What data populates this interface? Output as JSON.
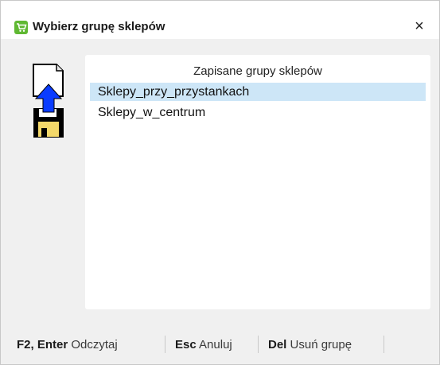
{
  "window": {
    "title": "Wybierz grupę sklepów",
    "close_label": "×"
  },
  "icons": {
    "title_icon": "shopping-cart-icon",
    "side_icon": "load-from-disk-icon"
  },
  "list": {
    "header": "Zapisane grupy sklepów",
    "items": [
      {
        "label": "Sklepy_przy_przystankach",
        "selected": true
      },
      {
        "label": "Sklepy_w_centrum",
        "selected": false
      }
    ]
  },
  "statusbar": {
    "hints": [
      {
        "key": "F2, Enter",
        "action": "Odczytaj"
      },
      {
        "key": "Esc",
        "action": "Anuluj"
      },
      {
        "key": "Del",
        "action": "Usuń grupę"
      }
    ]
  },
  "colors": {
    "selection": "#cde6f7",
    "cart_icon": "#5fb832",
    "arrow": "#0a3cff",
    "disk": "#000000"
  }
}
